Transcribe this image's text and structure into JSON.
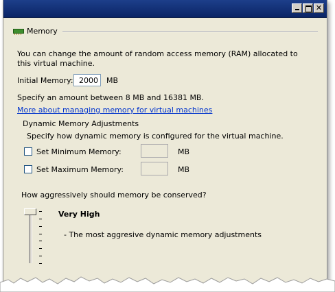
{
  "window": {
    "caption_buttons": [
      {
        "name": "minimize",
        "icon": "minimize-icon"
      },
      {
        "name": "maximize",
        "icon": "maximize-icon"
      },
      {
        "name": "close",
        "icon": "close-icon",
        "glyph": "✕"
      }
    ]
  },
  "memory_panel": {
    "title": "Memory",
    "icon": "memory-chip-icon",
    "description": "You can change the amount of random access memory (RAM) allocated to this virtual machine.",
    "initial_memory": {
      "label": "Initial Memory:",
      "value": "2000",
      "unit": "MB"
    },
    "range_text": "Specify an amount between 8 MB and 16381 MB.",
    "help_link": "More about managing memory for virtual machines",
    "dynamic": {
      "title": "Dynamic Memory Adjustments",
      "subtitle": "Specify how dynamic memory is configured for the virtual machine.",
      "set_minimum": {
        "label": "Set Minimum Memory:",
        "checked": false,
        "value": "",
        "unit": "MB"
      },
      "set_maximum": {
        "label": "Set Maximum Memory:",
        "checked": false,
        "value": "",
        "unit": "MB"
      }
    },
    "conservation": {
      "question": "How aggressively should memory be conserved?",
      "level": "Very High",
      "level_description": "- The most aggresive dynamic memory adjustments",
      "slider_position_fraction": 1.0,
      "tick_count": 8
    }
  },
  "colors": {
    "titlebar": "#0a2466",
    "panel_bg": "#ece9d8",
    "link": "#0033cc"
  }
}
